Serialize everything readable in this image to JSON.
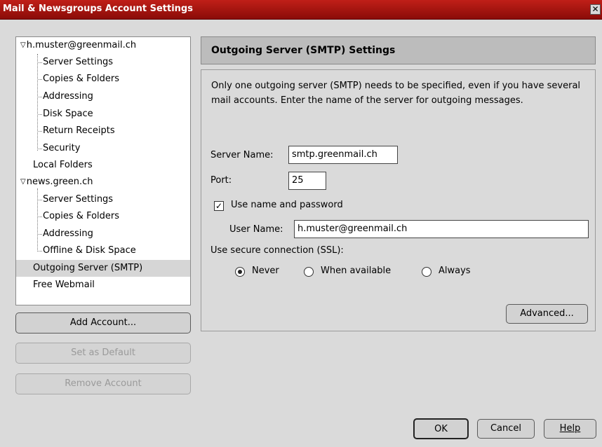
{
  "window": {
    "title": "Mail & Newsgroups Account Settings",
    "close_glyph": "✕"
  },
  "tree": {
    "items": [
      {
        "label": "h.muster@greenmail.ch",
        "level": 0,
        "expanded": true
      },
      {
        "label": "Server Settings",
        "level": 1
      },
      {
        "label": "Copies & Folders",
        "level": 1
      },
      {
        "label": "Addressing",
        "level": 1
      },
      {
        "label": "Disk Space",
        "level": 1
      },
      {
        "label": "Return Receipts",
        "level": 1
      },
      {
        "label": "Security",
        "level": 1
      },
      {
        "label": "Local Folders",
        "level": 0
      },
      {
        "label": "news.green.ch",
        "level": 0,
        "expanded": true
      },
      {
        "label": "Server Settings",
        "level": 1
      },
      {
        "label": "Copies & Folders",
        "level": 1
      },
      {
        "label": "Addressing",
        "level": 1
      },
      {
        "label": "Offline & Disk Space",
        "level": 1
      },
      {
        "label": "Outgoing Server (SMTP)",
        "level": 0,
        "selected": true
      },
      {
        "label": "Free Webmail",
        "level": 0
      }
    ],
    "expand_icon": "▽"
  },
  "buttons": {
    "add_account": "Add Account...",
    "set_default": "Set as Default",
    "remove_account": "Remove Account",
    "advanced": "Advanced...",
    "ok": "OK",
    "cancel": "Cancel",
    "help": "Help"
  },
  "panel": {
    "title": "Outgoing Server (SMTP) Settings",
    "description": "Only one outgoing server (SMTP) needs to be specified, even if you have several mail accounts. Enter the name of the server for outgoing messages.",
    "server_name_label": "Server Name:",
    "server_name_value": "smtp.greenmail.ch",
    "port_label": "Port:",
    "port_value": "25",
    "use_auth_label": "Use name and password",
    "use_auth_checked": true,
    "check_glyph": "✓",
    "user_name_label": "User Name:",
    "user_name_value": "h.muster@greenmail.ch",
    "ssl_label": "Use secure connection (SSL):",
    "ssl_options": [
      "Never",
      "When available",
      "Always"
    ],
    "ssl_selected": "Never"
  }
}
